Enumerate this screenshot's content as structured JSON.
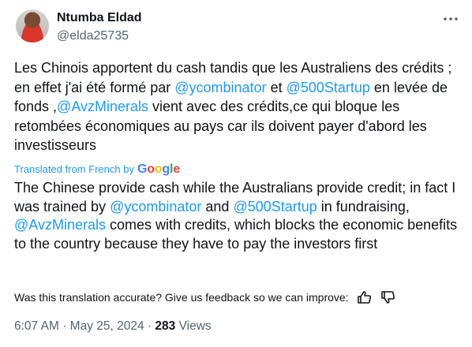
{
  "author": {
    "name": "Ntumba Eldad",
    "handle": "@elda25735"
  },
  "tweet": {
    "original_parts": [
      "Les Chinois apportent du cash tandis que les Australiens des crédits ; en effet j'ai été formé par ",
      "@ycombinator",
      " et ",
      "@500Startup",
      " en levée de fonds ,",
      "@AvzMinerals",
      " vient avec des crédits,ce qui bloque les retombées économiques au pays car ils doivent payer d'abord les investisseurs"
    ],
    "translated_label": "Translated from French by",
    "translator_logo": [
      "G",
      "o",
      "o",
      "g",
      "l",
      "e"
    ],
    "translation_parts": [
      "The Chinese provide cash while the Australians provide credit; in fact I was trained by ",
      "@ycombinator",
      " and ",
      "@500Startup",
      " in fundraising, ",
      "@AvzMinerals",
      " comes with credits, which blocks the economic benefits to the country because they have to pay the investors first"
    ]
  },
  "feedback": {
    "prompt": "Was this translation accurate? Give us feedback so we can improve:"
  },
  "meta": {
    "time": "6:07 AM",
    "separator": "·",
    "date": "May 25, 2024",
    "views_count": "283",
    "views_label": "Views"
  },
  "colors": {
    "link": "#1d9bf0",
    "secondary": "#536471",
    "text": "#0f1419"
  },
  "icons": [
    "more-icon",
    "thumbs-up-icon",
    "thumbs-down-icon"
  ]
}
